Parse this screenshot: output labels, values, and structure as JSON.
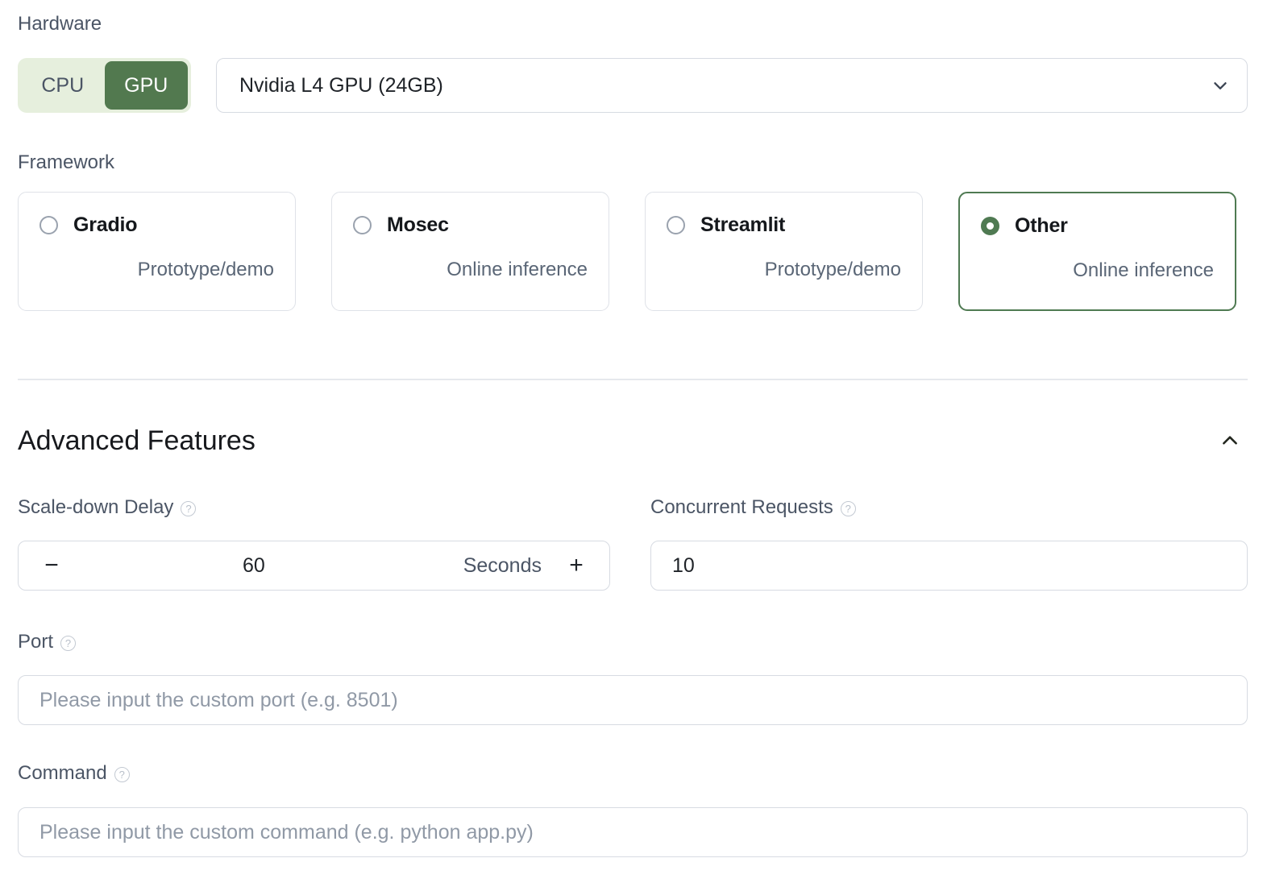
{
  "hardware": {
    "label": "Hardware",
    "toggle": {
      "cpu_label": "CPU",
      "gpu_label": "GPU",
      "selected": "GPU"
    },
    "select": {
      "value": "Nvidia L4 GPU (24GB)",
      "icon": "chevron-down-icon"
    }
  },
  "framework": {
    "label": "Framework",
    "selected": "Other",
    "options": [
      {
        "title": "Gradio",
        "subtitle": "Prototype/demo",
        "selected": false
      },
      {
        "title": "Mosec",
        "subtitle": "Online inference",
        "selected": false
      },
      {
        "title": "Streamlit",
        "subtitle": "Prototype/demo",
        "selected": false
      },
      {
        "title": "Other",
        "subtitle": "Online inference",
        "selected": true
      }
    ]
  },
  "advanced": {
    "title": "Advanced Features",
    "collapse_icon": "chevron-up-icon",
    "expanded": true,
    "scale_down_delay": {
      "label": "Scale-down Delay",
      "help_icon": "question-mark-circle-icon",
      "value": "60",
      "unit": "Seconds",
      "decrement_label": "−",
      "increment_label": "+"
    },
    "concurrent_requests": {
      "label": "Concurrent Requests",
      "help_icon": "question-mark-circle-icon",
      "value": "10",
      "placeholder": ""
    },
    "port": {
      "label": "Port",
      "help_icon": "question-mark-circle-icon",
      "value": "",
      "placeholder": "Please input the custom port (e.g. 8501)"
    },
    "command": {
      "label": "Command",
      "help_icon": "question-mark-circle-icon",
      "value": "",
      "placeholder": "Please input the custom command (e.g. python app.py)"
    }
  },
  "colors": {
    "accent_green": "#52794f",
    "accent_green_bg": "#e6efdd",
    "selected_border": "#4f7a52",
    "label_gray": "#4b5565",
    "border_gray": "#d7dbe2",
    "placeholder_gray": "#9099a6"
  },
  "help_glyph": "?"
}
